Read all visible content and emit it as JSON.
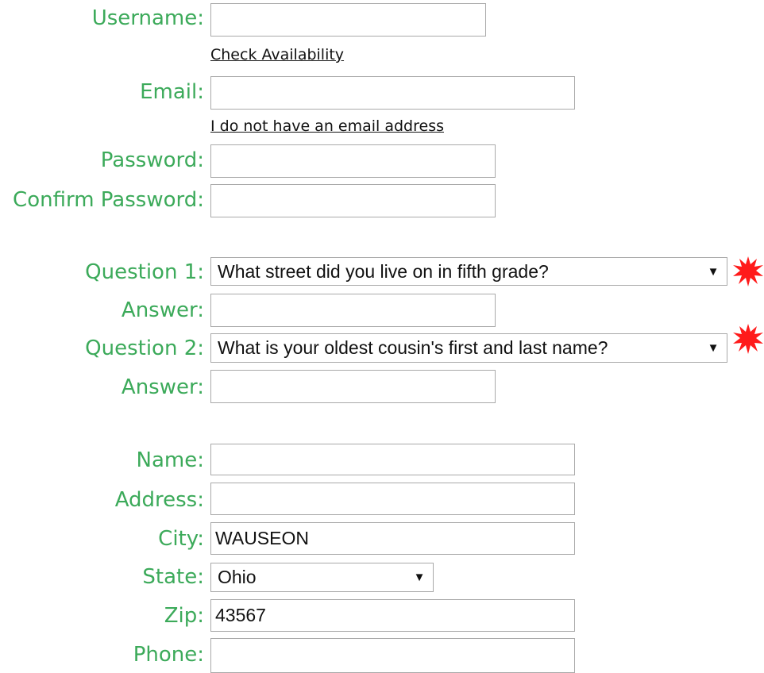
{
  "colors": {
    "label": "#3caa5a",
    "star": "#ff1a1a"
  },
  "account": {
    "username_label": "Username:",
    "username_value": "",
    "check_availability": "Check Availability",
    "email_label": "Email:",
    "email_value": "",
    "no_email": "I do not have an email address",
    "password_label": "Password:",
    "password_value": "",
    "confirm_label": "Confirm Password:",
    "confirm_value": ""
  },
  "security": {
    "q1_label": "Question 1:",
    "q1_value": "What street did you live on in fifth grade?",
    "a1_label": "Answer:",
    "a1_value": "",
    "q2_label": "Question 2:",
    "q2_value": "What is your oldest cousin's first and last name?",
    "a2_label": "Answer:",
    "a2_value": "",
    "required_icon": "red-star-burst-icon"
  },
  "contact": {
    "name_label": "Name:",
    "name_value": "",
    "address_label": "Address:",
    "address_value": "",
    "city_label": "City:",
    "city_value": "WAUSEON",
    "state_label": "State:",
    "state_value": "Ohio",
    "zip_label": "Zip:",
    "zip_value": "43567",
    "phone_label": "Phone:",
    "phone_value": ""
  }
}
